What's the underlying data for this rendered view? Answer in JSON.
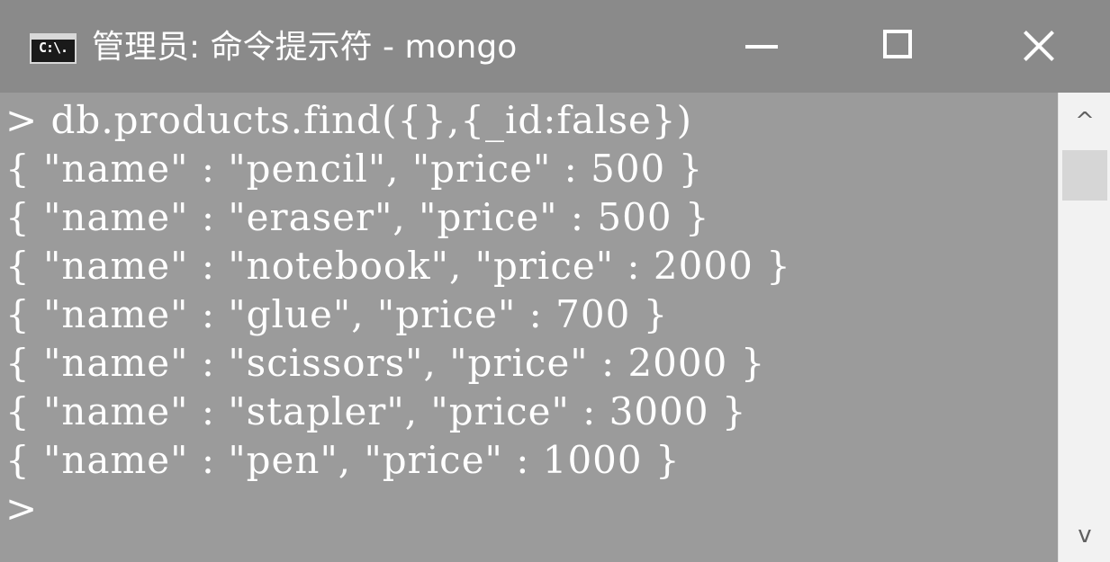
{
  "window": {
    "title": "管理员: 命令提示符 - mongo",
    "icon_label": "C:\\.",
    "icon_name": "cmd-app-icon",
    "controls": {
      "minimize_icon": "minimize-icon",
      "maximize_icon": "maximize-icon",
      "close_icon": "close-icon"
    }
  },
  "console": {
    "lines": [
      "> db.products.find({},{_id:false})",
      "{ \"name\" : \"pencil\", \"price\" : 500 }",
      "{ \"name\" : \"eraser\", \"price\" : 500 }",
      "{ \"name\" : \"notebook\", \"price\" : 2000 }",
      "{ \"name\" : \"glue\", \"price\" : 700 }",
      "{ \"name\" : \"scissors\", \"price\" : 2000 }",
      "{ \"name\" : \"stapler\", \"price\" : 3000 }",
      "{ \"name\" : \"pen\", \"price\" : 1000 }",
      ">"
    ]
  },
  "scrollbar": {
    "up_arrow": "^",
    "down_arrow": "v"
  },
  "colors": {
    "titlebar": "#8a8a8a",
    "console_bg": "#9b9b9b",
    "text": "#ffffff",
    "scrollbar_bg": "#f2f2f2"
  }
}
